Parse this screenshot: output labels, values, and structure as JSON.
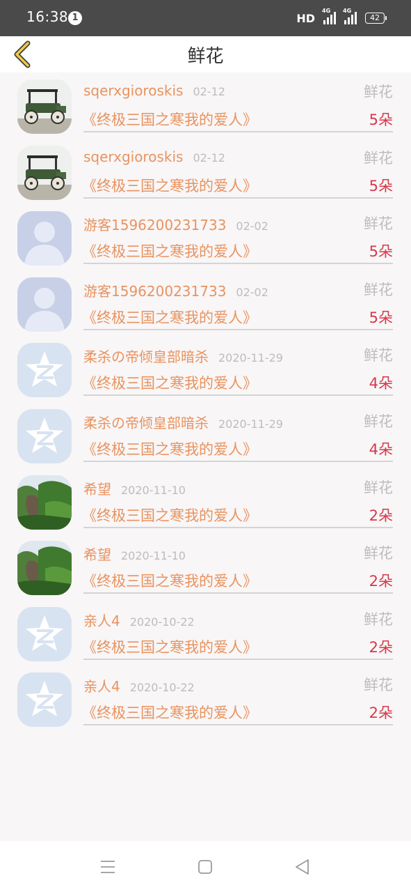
{
  "status_bar": {
    "time": "16:38",
    "notification_count": "1",
    "network": "HD",
    "signal_1": "4G",
    "signal_2": "4G",
    "battery": "42"
  },
  "header": {
    "title": "鲜花"
  },
  "colors": {
    "name": "#e8935f",
    "date": "#bdbdbd",
    "count": "#d7384a"
  },
  "entries": [
    {
      "avatar": "car-photo",
      "name": "sqerxgioroskis",
      "date": "02-12",
      "gift": "鲜花",
      "book": "《终极三国之寒我的爱人》",
      "count": "5朵"
    },
    {
      "avatar": "car-photo",
      "name": "sqerxgioroskis",
      "date": "02-12",
      "gift": "鲜花",
      "book": "《终极三国之寒我的爱人》",
      "count": "5朵"
    },
    {
      "avatar": "default-person",
      "name": "游客1596200231733",
      "date": "02-02",
      "gift": "鲜花",
      "book": "《终极三国之寒我的爱人》",
      "count": "5朵"
    },
    {
      "avatar": "default-person",
      "name": "游客1596200231733",
      "date": "02-02",
      "gift": "鲜花",
      "book": "《终极三国之寒我的爱人》",
      "count": "5朵"
    },
    {
      "avatar": "qzone-star",
      "name": "柔杀の帝倾皇部暗杀",
      "date": "2020-11-29",
      "gift": "鲜花",
      "book": "《终极三国之寒我的爱人》",
      "count": "4朵"
    },
    {
      "avatar": "qzone-star",
      "name": "柔杀の帝倾皇部暗杀",
      "date": "2020-11-29",
      "gift": "鲜花",
      "book": "《终极三国之寒我的爱人》",
      "count": "4朵"
    },
    {
      "avatar": "landscape-photo",
      "name": "希望",
      "date": "2020-11-10",
      "gift": "鲜花",
      "book": "《终极三国之寒我的爱人》",
      "count": "2朵"
    },
    {
      "avatar": "landscape-photo",
      "name": "希望",
      "date": "2020-11-10",
      "gift": "鲜花",
      "book": "《终极三国之寒我的爱人》",
      "count": "2朵"
    },
    {
      "avatar": "qzone-star",
      "name": "亲人4",
      "date": "2020-10-22",
      "gift": "鲜花",
      "book": "《终极三国之寒我的爱人》",
      "count": "2朵"
    },
    {
      "avatar": "qzone-star",
      "name": "亲人4",
      "date": "2020-10-22",
      "gift": "鲜花",
      "book": "《终极三国之寒我的爱人》",
      "count": "2朵"
    }
  ]
}
